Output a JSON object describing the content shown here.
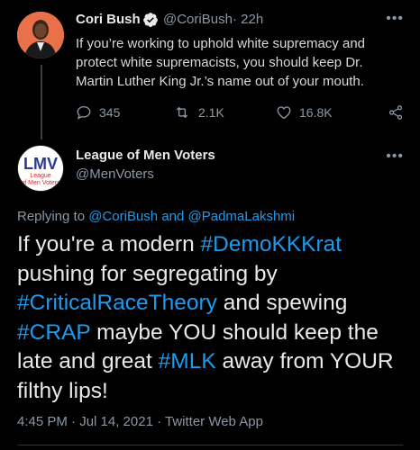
{
  "tweet1": {
    "name": "Cori Bush",
    "handle": "@CoriBush",
    "time": "· 22h",
    "text": "If you’re working to uphold white supremacy and protect white supremacists, you should keep Dr. Martin Luther King Jr.’s name out of your mouth.",
    "replies": "345",
    "retweets": "2.1K",
    "likes": "16.8K"
  },
  "tweet2": {
    "name": "League of Men Voters",
    "handle": "@MenVoters",
    "avatar_logo": "LMV",
    "avatar_caption_1": "League",
    "avatar_caption_2": "of Men Voters",
    "replying_prefix": "Replying to",
    "replying_mention1": "@CoriBush",
    "replying_and": "and",
    "replying_mention2": "@PadmaLakshmi",
    "text_parts": {
      "p1": "If you're a modern ",
      "h1": "#DemoKKKrat",
      "p2": " pushing for segregating by ",
      "h2": "#CriticalRaceTheory",
      "p3": " and spewing ",
      "h3": "#CRAP",
      "p4": " maybe YOU should keep the late and great ",
      "h4": "#MLK",
      "p5": " away from YOUR filthy lips!"
    },
    "meta": "4:45 PM · Jul 14, 2021 · Twitter Web App"
  },
  "icons": {
    "verified": "verified-badge-icon",
    "more": "more-options-icon",
    "reply": "reply-icon",
    "retweet": "retweet-icon",
    "like": "like-icon",
    "share": "share-icon"
  },
  "colors": {
    "background": "#000000",
    "link": "#1d9bf0",
    "muted": "#8b98a5",
    "avatar1_bg": "#e8714a",
    "logo_blue": "#2b3a8c",
    "logo_red": "#d62828"
  }
}
